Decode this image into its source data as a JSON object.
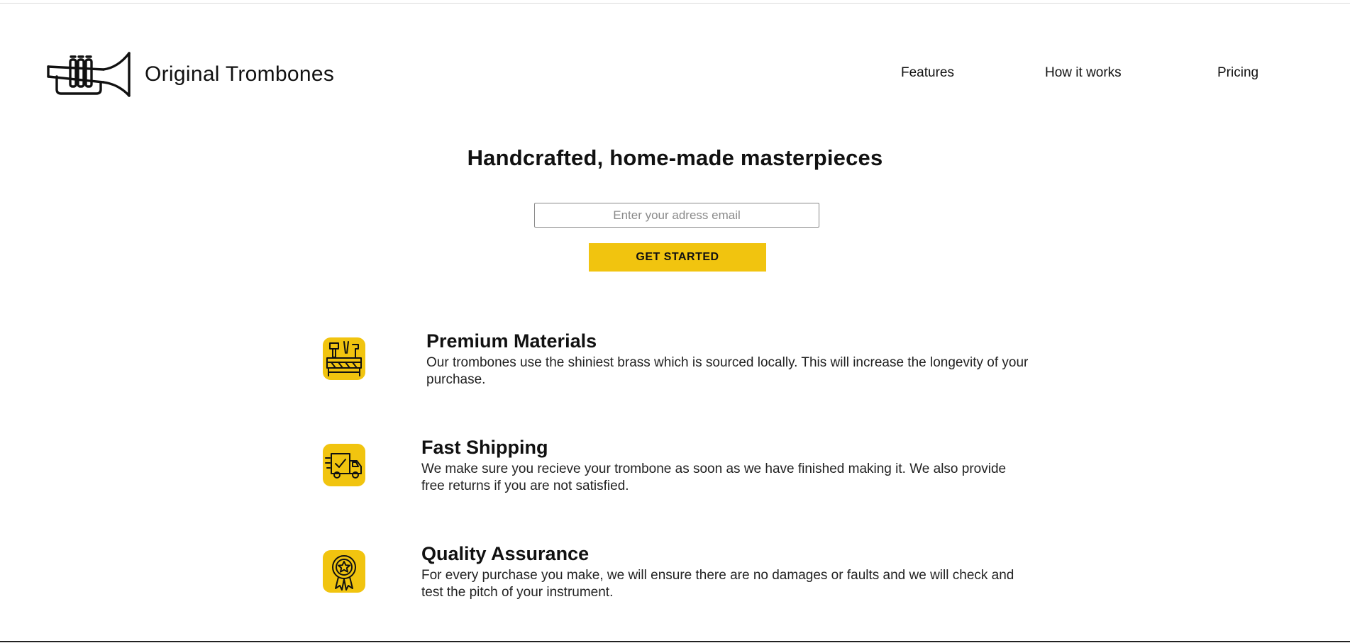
{
  "header": {
    "brand_name": "Original Trombones",
    "logo_icon": "trumpet-icon",
    "nav": [
      {
        "label": "Features"
      },
      {
        "label": "How it works"
      },
      {
        "label": "Pricing"
      }
    ]
  },
  "hero": {
    "title": "Handcrafted, home-made masterpieces",
    "email_placeholder": "Enter your adress email",
    "email_value": "",
    "cta_label": "GET STARTED"
  },
  "features": [
    {
      "icon": "workbench-tools-icon",
      "title": "Premium Materials",
      "description": "Our trombones use the shiniest brass which is sourced locally. This will increase the longevity of your purchase."
    },
    {
      "icon": "delivery-truck-icon",
      "title": "Fast Shipping",
      "description": "We make sure you recieve your trombone as soon as we have finished making it. We also provide free returns if you are not satisfied."
    },
    {
      "icon": "award-badge-icon",
      "title": "Quality Assurance",
      "description": "For every purchase you make, we will ensure there are no damages or faults and we will check and test the pitch of your instrument."
    }
  ],
  "colors": {
    "accent": "#f1c40f",
    "text": "#111111",
    "background": "#ffffff"
  }
}
